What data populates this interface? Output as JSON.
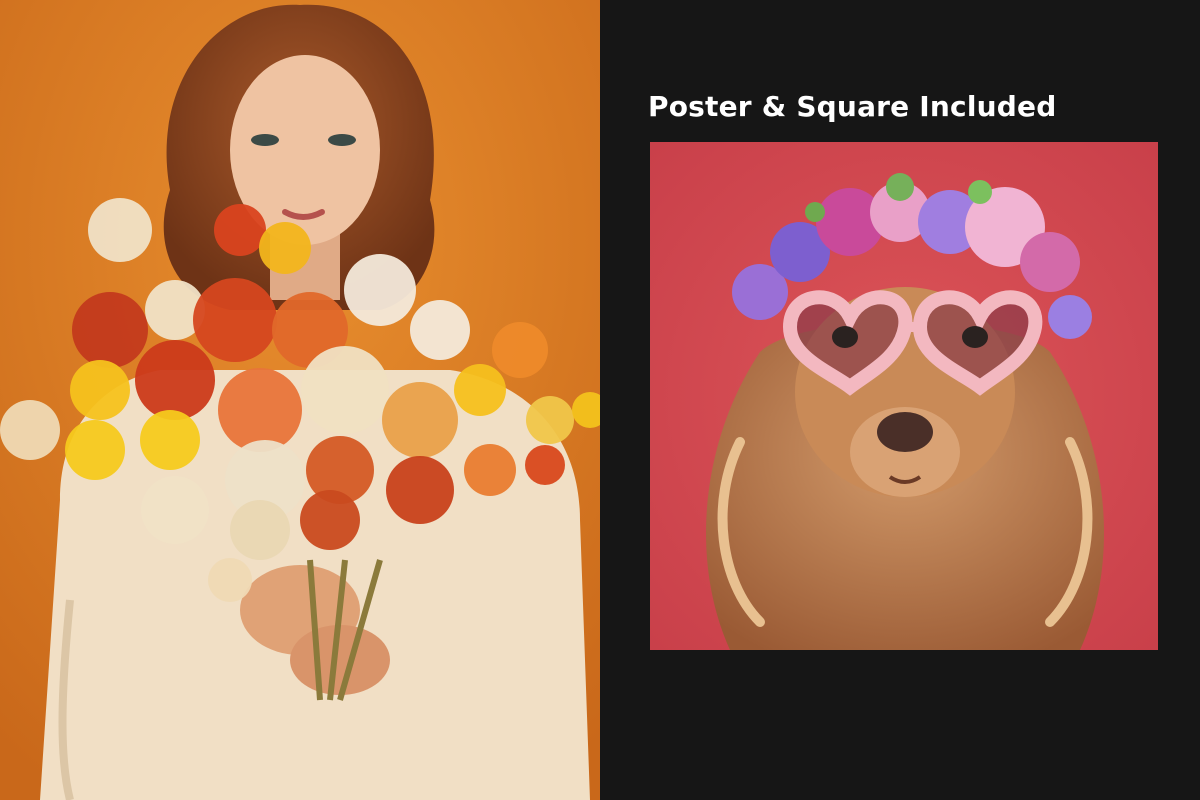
{
  "caption": {
    "text": "Poster & Square Included"
  },
  "colors": {
    "background": "#161616",
    "poster_backdrop": "#d9791f",
    "square_backdrop": "#d64a4f",
    "caption_text": "#ffffff"
  },
  "poster": {
    "subject": "woman-holding-flower-bouquet"
  },
  "square": {
    "subject": "dog-with-heart-glasses-and-flower-crown"
  }
}
